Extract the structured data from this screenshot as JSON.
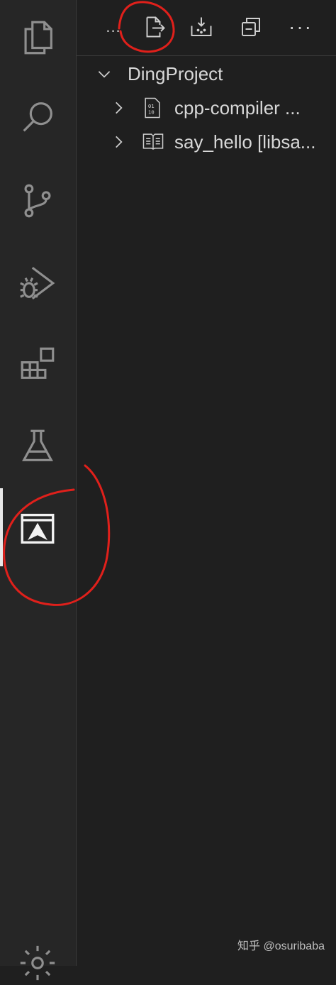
{
  "activity_bar": {
    "items": [
      {
        "name": "explorer-icon"
      },
      {
        "name": "search-icon"
      },
      {
        "name": "source-control-icon"
      },
      {
        "name": "run-debug-icon"
      },
      {
        "name": "extensions-icon"
      },
      {
        "name": "testing-icon"
      },
      {
        "name": "arkts-panel-icon",
        "active": true
      },
      {
        "name": "settings-gear-icon"
      }
    ]
  },
  "toolbar": {
    "left_ellipsis": "...",
    "more_actions": "···",
    "icons": [
      "export-file-icon",
      "download-install-icon",
      "collapse-all-icon"
    ]
  },
  "tree": {
    "root": {
      "label": "DingProject",
      "expanded": true
    },
    "children": [
      {
        "label": "cpp-compiler ...",
        "icon": "binary-file-icon"
      },
      {
        "label": "say_hello [libsa...",
        "icon": "book-icon"
      }
    ]
  },
  "watermark": "知乎 @osuribaba",
  "colors": {
    "background": "#1f1f1f",
    "activity_bar": "#262626",
    "icon": "#8f8f8f",
    "annotation_red": "#e0201b"
  }
}
